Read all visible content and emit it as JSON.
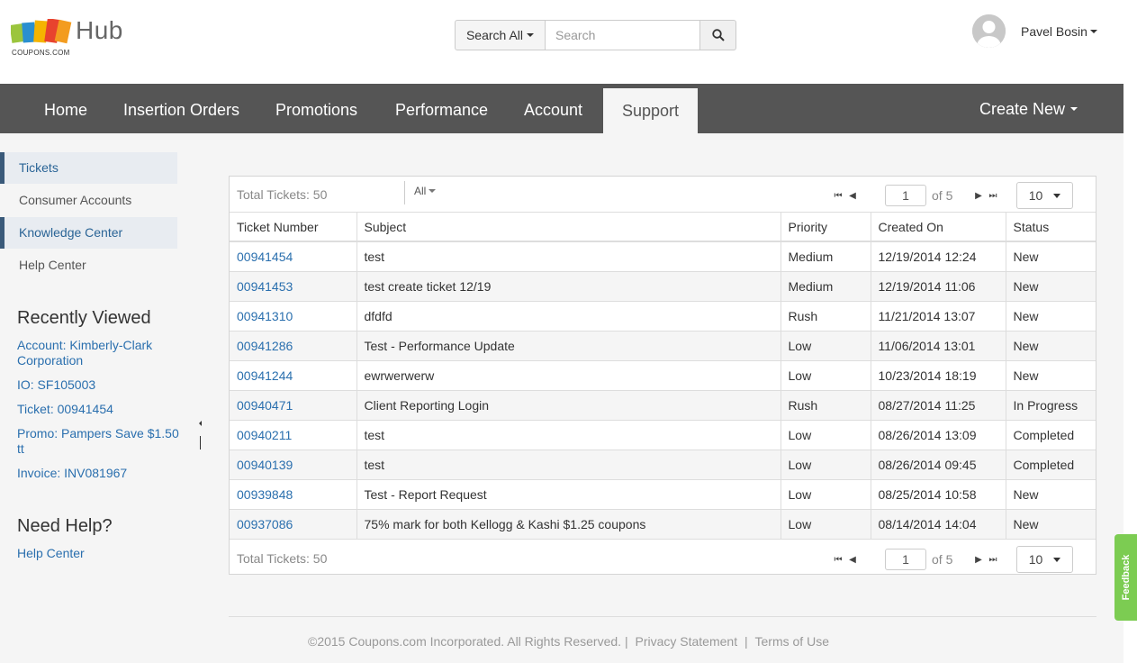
{
  "brand": {
    "name": "Hub",
    "sub": "COUPONS.COM",
    "colors": [
      "#9bc53d",
      "#2a8fd0",
      "#f5b400",
      "#e8432e",
      "#f39c1f"
    ]
  },
  "search": {
    "scope_label": "Search All",
    "placeholder": "Search",
    "button_icon": "search-icon"
  },
  "user": {
    "name": "Pavel Bosin"
  },
  "nav": {
    "items": [
      {
        "label": "Home"
      },
      {
        "label": "Insertion Orders"
      },
      {
        "label": "Promotions"
      },
      {
        "label": "Performance"
      },
      {
        "label": "Account"
      },
      {
        "label": "Support",
        "active": true
      }
    ],
    "create_new": "Create New"
  },
  "sidebar": {
    "items": [
      {
        "label": "Tickets",
        "highlighted": true
      },
      {
        "label": "Consumer Accounts"
      },
      {
        "label": "Knowledge Center",
        "highlighted": true
      },
      {
        "label": "Help Center"
      }
    ],
    "recently_viewed_heading": "Recently Viewed",
    "recently_viewed": [
      "Account: Kimberly-Clark Corporation",
      "IO: SF105003",
      "Ticket: 00941454",
      "Promo: Pampers Save $1.50 tt",
      "Invoice: INV081967"
    ],
    "need_help_heading": "Need Help?",
    "need_help_link": "Help Center"
  },
  "tickets": {
    "total_label": "Total Tickets: 50",
    "filter_label": "All",
    "page_value": "1",
    "of_label": "of 5",
    "page_size": "10",
    "columns": [
      "Ticket Number",
      "Subject",
      "Priority",
      "Created On",
      "Status"
    ],
    "rows": [
      [
        "00941454",
        "test",
        "Medium",
        "12/19/2014 12:24",
        "New"
      ],
      [
        "00941453",
        "test create ticket 12/19",
        "Medium",
        "12/19/2014 11:06",
        "New"
      ],
      [
        "00941310",
        "dfdfd",
        "Rush",
        "11/21/2014 13:07",
        "New"
      ],
      [
        "00941286",
        "Test - Performance Update",
        "Low",
        "11/06/2014 13:01",
        "New"
      ],
      [
        "00941244",
        "ewrwerwerw",
        "Low",
        "10/23/2014 18:19",
        "New"
      ],
      [
        "00940471",
        "Client Reporting Login",
        "Rush",
        "08/27/2014 11:25",
        "In Progress"
      ],
      [
        "00940211",
        "test",
        "Low",
        "08/26/2014 13:09",
        "Completed"
      ],
      [
        "00940139",
        "test",
        "Low",
        "08/26/2014 09:45",
        "Completed"
      ],
      [
        "00939848",
        "Test - Report Request",
        "Low",
        "08/25/2014 10:58",
        "New"
      ],
      [
        "00937086",
        "75% mark for both Kellogg & Kashi $1.25 coupons",
        "Low",
        "08/14/2014 14:04",
        "New"
      ]
    ]
  },
  "footer": {
    "copyright": "©2015 Coupons.com Incorporated. All Rights Reserved. |",
    "privacy": "Privacy Statement",
    "sep": "|",
    "terms": "Terms of Use"
  },
  "feedback": {
    "label": "Feedback",
    "color": "#7ccc52"
  }
}
